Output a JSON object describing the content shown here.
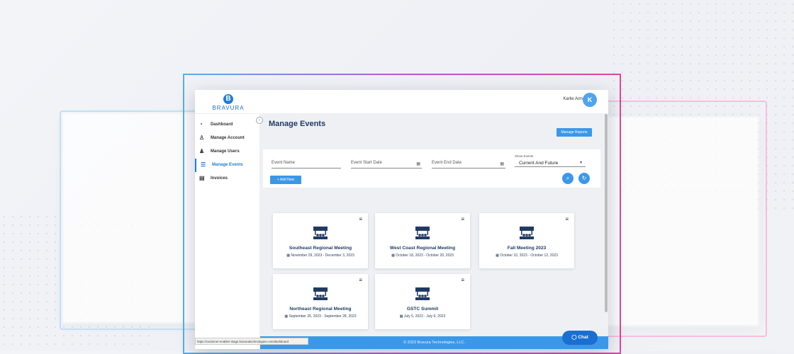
{
  "brand": {
    "logo_letter": "B",
    "name": "BRAVURA",
    "color": "#1e7fd6"
  },
  "user": {
    "name": "Karlie Arm",
    "initial": "K"
  },
  "sidebar": {
    "collapse_icon": "chevron-left-icon",
    "items": [
      {
        "label": "Dashboard",
        "icon": "dashboard-icon"
      },
      {
        "label": "Manage Account",
        "icon": "user-icon"
      },
      {
        "label": "Manage Users",
        "icon": "users-icon"
      },
      {
        "label": "Manage Events",
        "icon": "list-icon",
        "active": true
      },
      {
        "label": "Invoices",
        "icon": "document-icon"
      }
    ]
  },
  "page": {
    "title": "Manage Events",
    "manage_reports_label": "Manage Reports"
  },
  "filters": {
    "event_name_placeholder": "Event Name",
    "start_date_placeholder": "Event Start Date",
    "end_date_placeholder": "Event End Date",
    "show_events_label": "Show Events",
    "show_events_value": "Current And Future",
    "add_new_label": "+ Add New"
  },
  "events": [
    {
      "name": "Southeast Regional Meeting",
      "dates": "November 29, 2023 - December 3, 2023"
    },
    {
      "name": "West Coast Regional Meeting",
      "dates": "October 18, 2023 - October 20, 2023"
    },
    {
      "name": "Fall Meeting 2023",
      "dates": "October 10, 2023 - October 12, 2023"
    },
    {
      "name": "Northeast Regional Meeting",
      "dates": "September 26, 2023 - September 28, 2023"
    },
    {
      "name": "GSTC Summit",
      "dates": "July 5, 2023 - July 9, 2023"
    }
  ],
  "footer": {
    "copyright": "© 2023 Bravura Technologies, LLC."
  },
  "status_url": "https://customer-enabler-stage.bravuratechnologies.com/dashboard",
  "chat": {
    "label": "Chat"
  },
  "colors": {
    "accent": "#3b98e8",
    "title": "#1f3b63",
    "frame_blue": "#5aaee8",
    "frame_pink": "#e0469a"
  }
}
